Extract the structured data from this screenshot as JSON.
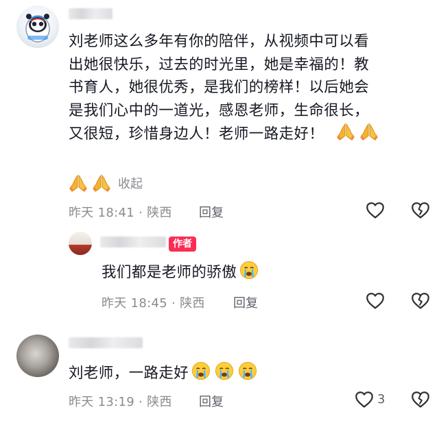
{
  "comments": [
    {
      "text_lines": [
        "刘老师这么多年有你的陪伴，从视频中可以看",
        "出她很快乐，过去的时光里，她是幸福的！教",
        "书育人，她很优秀，是我们的榜样！以后她会",
        "是我们心中的一道光，感恩老师，生命很长，",
        "又很短，珍惜身边人！老师一路走好！"
      ],
      "collapse_label": "收起",
      "time": "昨天 18:41",
      "location": "陕西",
      "reply_label": "回复"
    },
    {
      "author_badge": "作者",
      "text": "我们都是老师的骄傲",
      "time": "昨天 18:45",
      "location": "陕西",
      "reply_label": "回复"
    },
    {
      "text": "刘老师，一路走好",
      "time": "昨天 13:19",
      "location": "陕西",
      "reply_label": "回复",
      "like_count": "3"
    }
  ],
  "separator": " · ",
  "icons": {
    "like": "heart-outline-icon",
    "dislike": "broken-heart-icon",
    "pray": "praying-hands-emoji",
    "crying": "crying-face-emoji"
  },
  "colors": {
    "badge": "#fe2c55",
    "meta_text": "#8a8b91",
    "body_text": "#161823"
  }
}
